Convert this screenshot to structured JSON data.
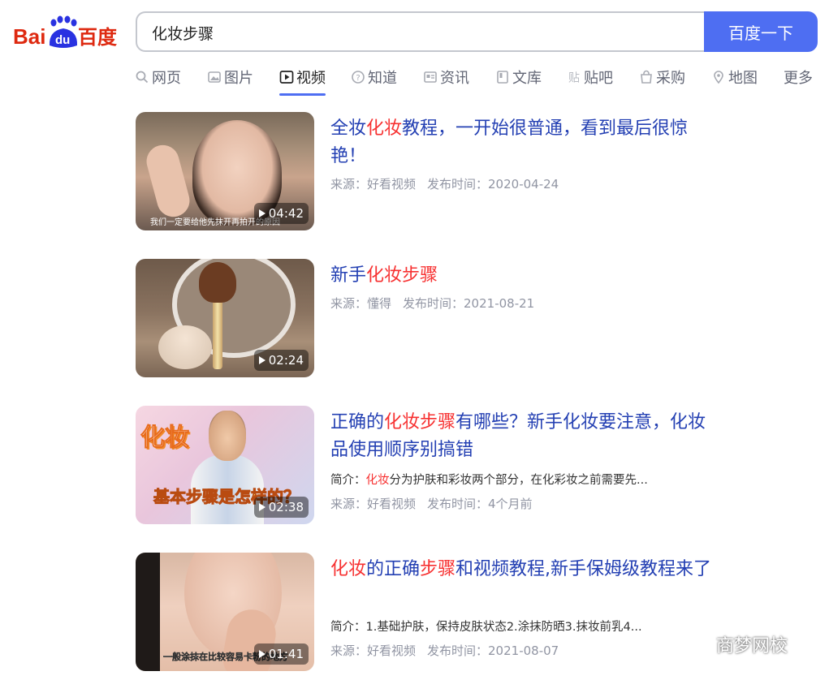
{
  "logo": {
    "text_bai": "Bai",
    "text_du": "du",
    "text_cn": "百度"
  },
  "search": {
    "query": "化妆步骤",
    "button_label": "百度一下"
  },
  "tabs": [
    {
      "label": "网页",
      "icon": "search-icon"
    },
    {
      "label": "图片",
      "icon": "image-icon"
    },
    {
      "label": "视频",
      "icon": "video-icon",
      "active": true
    },
    {
      "label": "知道",
      "icon": "question-icon"
    },
    {
      "label": "资讯",
      "icon": "news-icon"
    },
    {
      "label": "文库",
      "icon": "document-icon"
    },
    {
      "label": "贴吧",
      "icon": "tieba-icon"
    },
    {
      "label": "采购",
      "icon": "shopping-bag-icon"
    },
    {
      "label": "地图",
      "icon": "map-pin-icon"
    },
    {
      "label": "更多",
      "icon": ""
    }
  ],
  "results": [
    {
      "title_parts": [
        "全妆",
        "化妆",
        "教程，一开始很普通，看到最后很惊艳！"
      ],
      "duration": "04:42",
      "thumb_caption": "我们一定要给他先抹开再拍开的原因",
      "source": "来源：好看视频",
      "published": "发布时间：2020-04-24"
    },
    {
      "title_parts": [
        "新手",
        "化妆步骤",
        ""
      ],
      "duration": "02:24",
      "source": "来源：懂得",
      "published": "发布时间：2021-08-21"
    },
    {
      "title_parts": [
        "正确的",
        "化妆步骤",
        "有哪些？新手化妆要注意，化妆品使用顺序别搞错"
      ],
      "duration": "02:38",
      "thumb_caption_top": "化妆",
      "thumb_caption_bottom": "基本步骤是怎样的？",
      "desc_prefix": "简介：",
      "desc_highlight": "化妆",
      "desc_rest": "分为护肤和彩妆两个部分，在化彩妆之前需要先...",
      "source": "来源：好看视频",
      "published": "发布时间：4个月前"
    },
    {
      "title_parts": [
        "化妆",
        "的正确",
        "步骤",
        "和视频教程,新手保姆级教程来了"
      ],
      "duration": "01:41",
      "thumb_caption": "一般涂抹在比较容易卡粉的地方",
      "desc_prefix": "简介：",
      "desc_rest": "1.基础护肤，保持皮肤状态2.涂抹防晒3.抹妆前乳4...",
      "source": "来源：好看视频",
      "published": "发布时间：2021-08-07"
    }
  ],
  "watermark": {
    "text": "商梦网校"
  },
  "colors": {
    "brand_blue": "#4e6ef2",
    "title_blue": "#2440b3",
    "highlight_red": "#f73131",
    "baidu_red": "#de2910",
    "meta_gray": "#9195a3"
  }
}
